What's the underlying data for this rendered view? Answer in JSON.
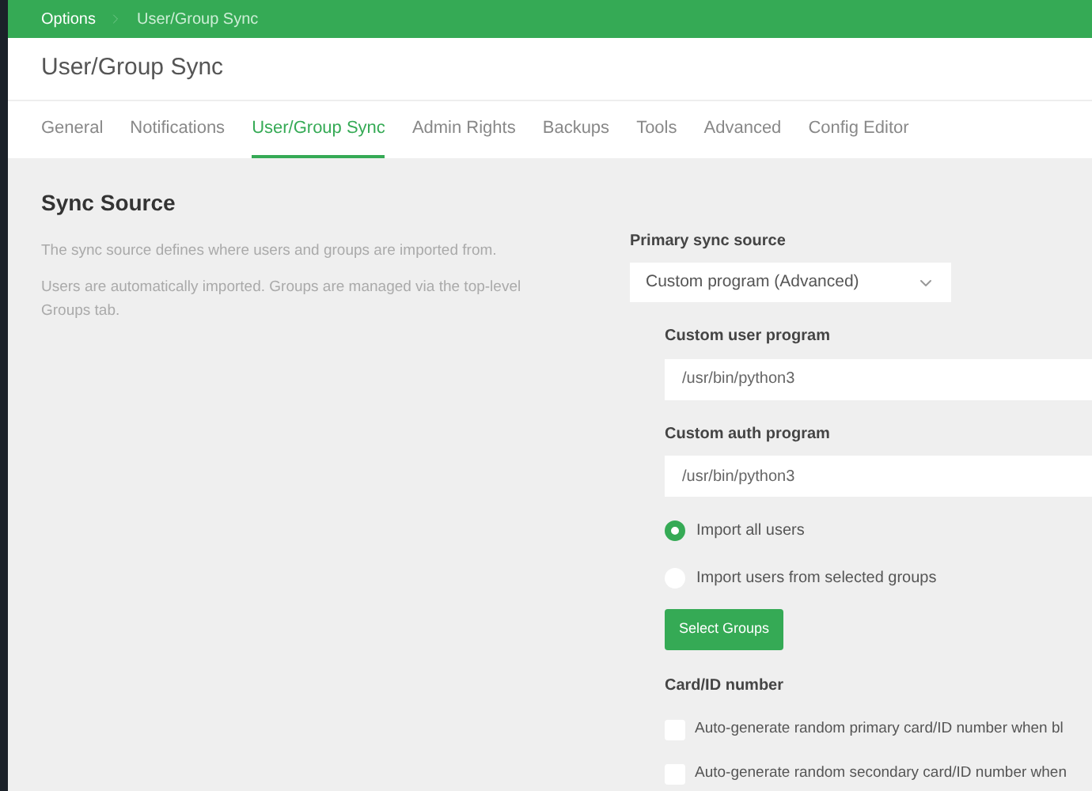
{
  "breadcrumb": [
    "Options",
    "User/Group Sync"
  ],
  "page_title": "User/Group Sync",
  "tabs": [
    {
      "label": "General",
      "selected": false
    },
    {
      "label": "Notifications",
      "selected": false
    },
    {
      "label": "User/Group Sync",
      "selected": true
    },
    {
      "label": "Admin Rights",
      "selected": false
    },
    {
      "label": "Backups",
      "selected": false
    },
    {
      "label": "Tools",
      "selected": false
    },
    {
      "label": "Advanced",
      "selected": false
    },
    {
      "label": "Config Editor",
      "selected": false
    }
  ],
  "section": {
    "title": "Sync Source",
    "paragraphs": [
      "The sync source defines where users and groups are imported from.",
      "Users are automatically imported. Groups are managed via the top-level Groups tab."
    ]
  },
  "primary_sync_source": {
    "label": "Primary sync source",
    "value": "Custom program (Advanced)"
  },
  "fields": [
    {
      "label": "Custom user program",
      "value": "/usr/bin/python3"
    },
    {
      "label": "Custom auth program",
      "value": "/usr/bin/python3"
    }
  ],
  "import_options": [
    {
      "label": "Import all users",
      "selected": true
    },
    {
      "label": "Import users from selected groups",
      "selected": false
    }
  ],
  "select_groups_button": "Select Groups",
  "card_id": {
    "title": "Card/ID number",
    "options": [
      {
        "label": "Auto-generate random primary card/ID number when bl",
        "checked": false
      },
      {
        "label": "Auto-generate random secondary card/ID number when",
        "checked": false
      }
    ]
  }
}
